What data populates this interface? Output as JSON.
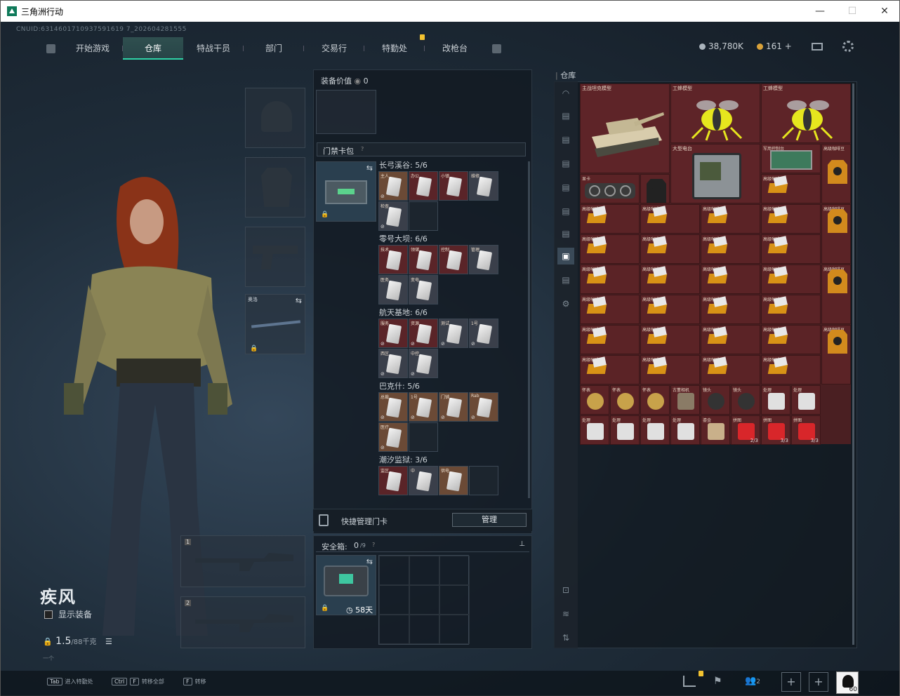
{
  "window": {
    "title": "三角洲行动",
    "min": "—",
    "max": "☐",
    "close": "✕"
  },
  "uid": "CNUID:6314601710937591619 7_202604281555",
  "nav": {
    "tabs": [
      "开始游戏",
      "仓库",
      "特战干员",
      "部门",
      "交易行",
      "特勤处",
      "改枪台"
    ],
    "active": 1
  },
  "currency": {
    "silver": "38,780K",
    "gold": "161 +"
  },
  "character": {
    "name": "疾风",
    "show_equipment": "显示装备",
    "weight": "1.5",
    "weight_max": "/88千克",
    "sub": "一个"
  },
  "equipment": {
    "value_label": "装备价值",
    "value": "0",
    "melee_label": "奥洛",
    "primary_1": "1",
    "primary_2": "2"
  },
  "keycard": {
    "title": "门禁卡包",
    "groups": [
      {
        "name": "长弓溪谷: 5/6",
        "cards": [
          {
            "tag": "主人",
            "c": "tan"
          },
          {
            "tag": "办公",
            "c": "red"
          },
          {
            "tag": "小镇",
            "c": "red"
          },
          {
            "tag": "维修",
            "c": "gray"
          },
          {
            "tag": "检查",
            "c": "gray"
          }
        ]
      },
      {
        "name": "零号大坝: 6/6",
        "cards": [
          {
            "tag": "技术",
            "c": "red"
          },
          {
            "tag": "领储",
            "c": "red"
          },
          {
            "tag": "控制",
            "c": "red"
          },
          {
            "tag": "管理",
            "c": "gray"
          },
          {
            "tag": "医务",
            "c": "gray"
          },
          {
            "tag": "变电",
            "c": "gray"
          }
        ]
      },
      {
        "name": "航天基地: 6/6",
        "cards": [
          {
            "tag": "服务",
            "c": "red"
          },
          {
            "tag": "资源",
            "c": "red"
          },
          {
            "tag": "测试",
            "c": "gray"
          },
          {
            "tag": "1号",
            "c": "gray"
          },
          {
            "tag": "西区",
            "c": "gray"
          },
          {
            "tag": "中控",
            "c": "gray"
          }
        ]
      },
      {
        "name": "巴克什: 5/6",
        "cards": [
          {
            "tag": "总裁",
            "c": "tan"
          },
          {
            "tag": "1号",
            "c": "tan"
          },
          {
            "tag": "门铺",
            "c": "tan"
          },
          {
            "tag": "Rab",
            "c": "tan"
          },
          {
            "tag": "医疗",
            "c": "tan"
          }
        ]
      },
      {
        "name": "潮汐监狱: 3/6",
        "cards": [
          {
            "tag": "监区",
            "c": "red"
          },
          {
            "tag": "中",
            "c": "gray"
          },
          {
            "tag": "供电",
            "c": "tan"
          }
        ]
      }
    ],
    "quick_manage": "快捷管理门卡",
    "manage_btn": "管理"
  },
  "safebox": {
    "title": "安全箱:",
    "cap": "0",
    "cap_max": "/9",
    "days": "58天"
  },
  "warehouse": {
    "title": "仓库",
    "big_items": [
      {
        "label": "主战坦克模型"
      },
      {
        "label": "工蜂模型"
      },
      {
        "label": "工蜂模型"
      },
      {
        "label": "大型电台"
      }
    ],
    "misc_labels": [
      "显卡",
      "军用控制台",
      "高级咖啡豆"
    ],
    "small_label": "高级咖啡豆",
    "row_items": [
      "怀表",
      "怀表",
      "怀表",
      "古董相机",
      "镜头",
      "镜头",
      "处理",
      "处理",
      "处理",
      "处理",
      "处理",
      "处理",
      "鎏金",
      "拼图",
      "拼图",
      "拼图"
    ],
    "counts": [
      "2/3",
      "3/3",
      "3/3"
    ]
  },
  "bottom": {
    "hints": [
      {
        "key": "Tab",
        "text": "进入特勤处"
      },
      {
        "key": "Ctrl",
        "key2": "F",
        "text": "转移全部"
      },
      {
        "key": "F",
        "text": "转移"
      }
    ],
    "party": "2",
    "avatar_level": "60"
  }
}
